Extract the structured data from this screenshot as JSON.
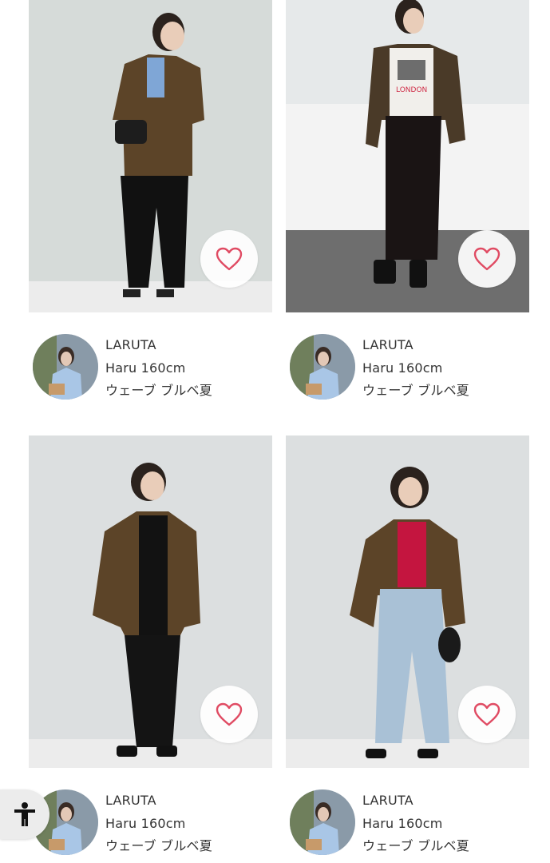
{
  "colors": {
    "heart": "#e04b63",
    "background": "#ffffff",
    "text": "#333333",
    "a11y_button": "#ececec"
  },
  "icons": {
    "favorite": "heart-outline-icon",
    "accessibility": "accessibility-person-icon"
  },
  "posts": [
    {
      "brand": "LARUTA",
      "staff": "Haru 160cm",
      "tags": "ウェーブ ブルベ夏"
    },
    {
      "brand": "LARUTA",
      "staff": "Haru 160cm",
      "tags": "ウェーブ ブルベ夏"
    },
    {
      "brand": "LARUTA",
      "staff": "Haru 160cm",
      "tags": "ウェーブ ブルベ夏"
    },
    {
      "brand": "LARUTA",
      "staff": "Haru 160cm",
      "tags": "ウェーブ ブルベ夏"
    }
  ]
}
